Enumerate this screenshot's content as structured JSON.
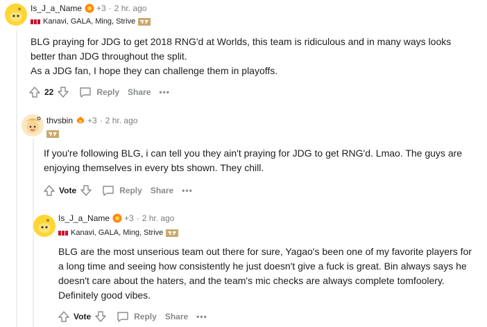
{
  "comments": [
    {
      "username": "Is_J_a_Name",
      "karma": "+3",
      "time": "2 hr. ago",
      "flair": "Kanavi, GALA, Ming, Strive",
      "body": [
        "BLG praying for JDG to get 2018 RNG'd at Worlds, this team is ridiculous and in many ways looks better than JDG throughout the split.",
        "As a JDG fan, I hope they can challenge them in playoffs."
      ],
      "votes": "22",
      "reply_label": "Reply",
      "share_label": "Share",
      "more_label": "•••"
    },
    {
      "username": "thvsbin",
      "karma": "+3",
      "time": "2 hr. ago",
      "flair": "",
      "body": [
        "If you're following BLG, i can tell you they ain't praying for JDG to get RNG'd. Lmao. The guys are enjoying themselves in every bts shown. They chill."
      ],
      "votes": "Vote",
      "reply_label": "Reply",
      "share_label": "Share",
      "more_label": "•••"
    },
    {
      "username": "Is_J_a_Name",
      "karma": "+3",
      "time": "2 hr. ago",
      "flair": "Kanavi, GALA, Ming, Strive",
      "body": [
        "BLG are the most unserious team out there for sure, Yagao's been one of my favorite players for a long time and seeing how consistently he just doesn't give a fuck is great. Bin always says he doesn't care about the haters, and the team's mic checks are always complete tomfoolery. Definitely good vibes."
      ],
      "votes": "Vote",
      "reply_label": "Reply",
      "share_label": "Share",
      "more_label": "•••"
    }
  ],
  "colors": {
    "award": "#ff8717",
    "jdg_red": "#c8102e",
    "rng_gold": "#c9a96e",
    "meta_gray": "#7c7c7c",
    "action_gray": "#878a8c"
  }
}
